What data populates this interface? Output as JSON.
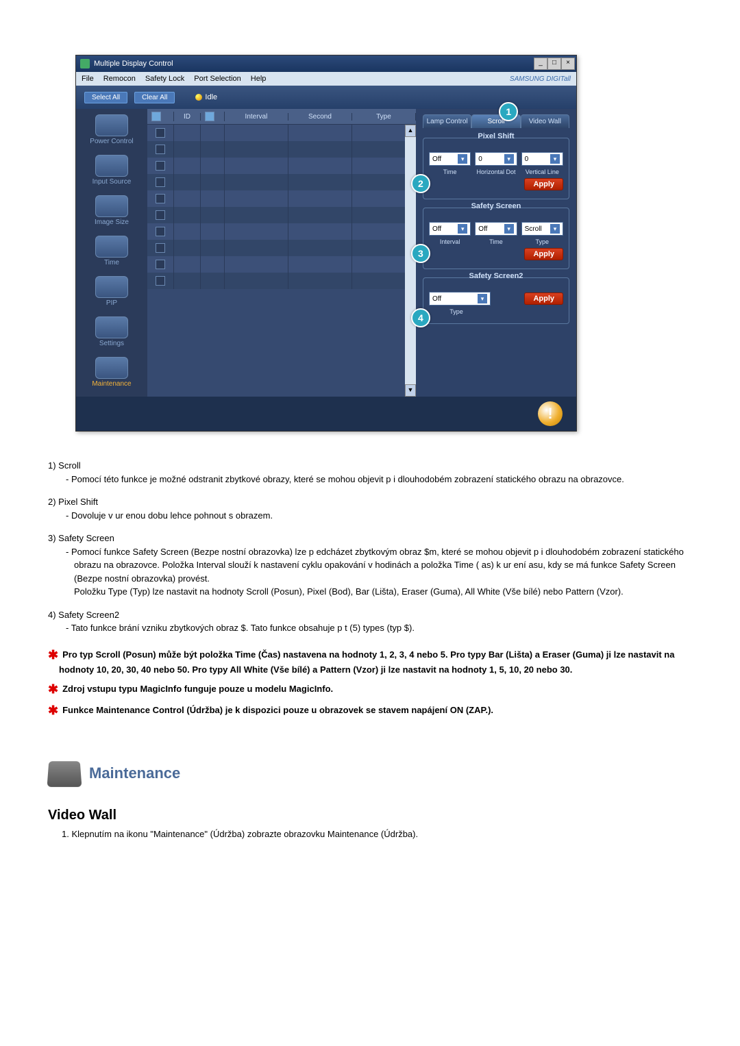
{
  "app": {
    "title": "Multiple Display Control",
    "brand": "SAMSUNG DIGITall"
  },
  "menu": {
    "file": "File",
    "remocon": "Remocon",
    "safety_lock": "Safety Lock",
    "port_selection": "Port Selection",
    "help": "Help"
  },
  "toolbar": {
    "select_all": "Select All",
    "clear_all": "Clear All",
    "idle": "Idle"
  },
  "sidebar": {
    "items": [
      {
        "label": "Power Control"
      },
      {
        "label": "Input Source"
      },
      {
        "label": "Image Size"
      },
      {
        "label": "Time"
      },
      {
        "label": "PIP"
      },
      {
        "label": "Settings"
      },
      {
        "label": "Maintenance"
      }
    ]
  },
  "grid": {
    "headers": {
      "c2": "ID",
      "c4": "Interval",
      "c5": "Second",
      "c6": "Type"
    }
  },
  "panel": {
    "tabs": {
      "lamp": "Lamp Control",
      "scroll": "Scroll",
      "video": "Video Wall"
    },
    "pixelshift": {
      "title": "Pixel Shift",
      "time": "Off",
      "timelbl": "Time",
      "hdot": "0",
      "hdotlbl": "Horizontal Dot",
      "vline": "0",
      "vlinelbl": "Vertical Line",
      "apply": "Apply"
    },
    "safetyscreen": {
      "title": "Safety Screen",
      "interval": "Off",
      "intlbl": "Interval",
      "time": "Off",
      "timelbl": "Time",
      "type": "Scroll",
      "typelbl": "Type",
      "apply": "Apply"
    },
    "safetyscreen2": {
      "title": "Safety Screen2",
      "type": "Off",
      "typelbl": "Type",
      "apply": "Apply"
    }
  },
  "callouts": {
    "c1": "1",
    "c2": "2",
    "c3": "3",
    "c4": "4"
  },
  "desc": {
    "i1n": "1)  Scroll",
    "i1t": "- Pomocí této funkce je možné odstranit zbytkové obrazy, které se mohou objevit p i dlouhodobém zobrazení statického obrazu na obrazovce.",
    "i2n": "2)  Pixel Shift",
    "i2t": "- Dovoluje v ur enou dobu lehce pohnout s obrazem.",
    "i3n": "3)  Safety Screen",
    "i3t1": "- Pomocí funkce Safety Screen (Bezpe nostní obrazovka) lze p edcházet zbytkovým obraz $m, které se mohou objevit p i dlouhodobém zobrazení statického obrazu na obrazovce.  Položka Interval slouží k nastavení cyklu opakování v hodinách a položka Time ( as) k ur ení asu, kdy se má funkce Safety Screen (Bezpe nostní obrazovka) provést.",
    "i3t2": "Položku Type (Typ) lze nastavit na hodnoty Scroll (Posun), Pixel (Bod), Bar (Lišta), Eraser (Guma), All White (Vše bílé) nebo Pattern (Vzor).",
    "i4n": "4)  Safety Screen2",
    "i4t": "- Tato funkce brání vzniku zbytkových obraz $. Tato funkce obsahuje p t (5) types (typ $).",
    "s1": "Pro typ Scroll (Posun) může být položka Time (Čas) nastavena na hodnoty 1, 2, 3, 4 nebo 5. Pro typy Bar (Lišta) a Eraser (Guma) ji lze nastavit na hodnoty 10, 20, 30, 40 nebo 50. Pro typy All White (Vše bílé) a Pattern (Vzor) ji lze nastavit na hodnoty 1, 5, 10, 20 nebo 30.",
    "s2": "Zdroj vstupu typu MagicInfo funguje pouze u modelu MagicInfo.",
    "s3": "Funkce Maintenance Control (Údržba) je k dispozici pouze u obrazovek se stavem napájení ON (ZAP.)."
  },
  "section": {
    "title": "Maintenance",
    "subhead": "Video Wall",
    "sub1": "1.  Klepnutím na ikonu \"Maintenance\" (Údržba) zobrazte obrazovku Maintenance (Údržba)."
  }
}
